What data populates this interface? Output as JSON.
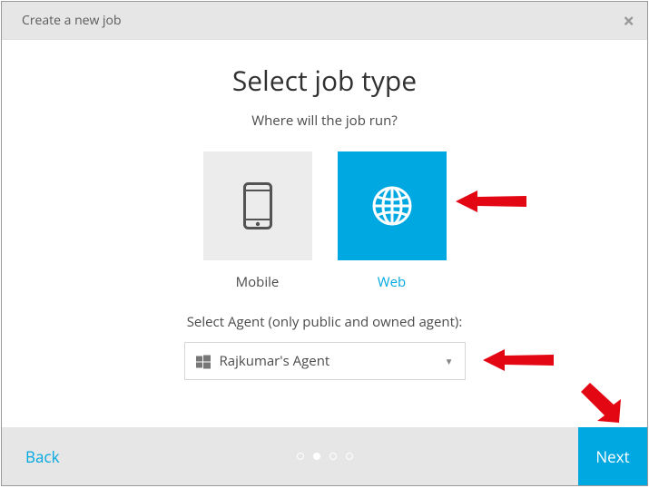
{
  "header": {
    "title": "Create a new job"
  },
  "main": {
    "heading": "Select job type",
    "subtitle": "Where will the job run?",
    "options": {
      "mobile": {
        "label": "Mobile",
        "selected": false
      },
      "web": {
        "label": "Web",
        "selected": true
      }
    },
    "agent": {
      "label": "Select Agent (only public and owned agent):",
      "selected": "Rajkumar's Agent"
    }
  },
  "footer": {
    "back": "Back",
    "next": "Next",
    "steps": {
      "total": 4,
      "current": 2
    }
  },
  "colors": {
    "accent": "#00a8e1"
  }
}
